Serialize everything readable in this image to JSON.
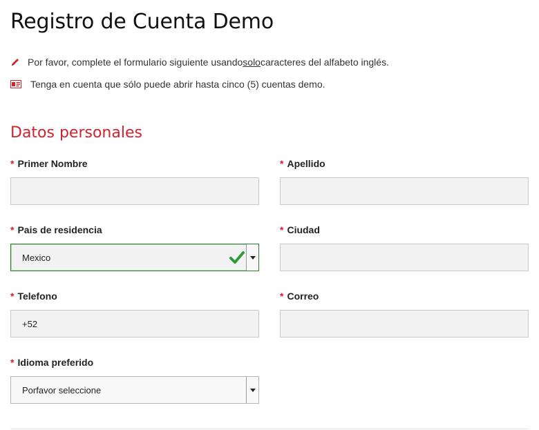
{
  "page": {
    "title": "Registro de Cuenta Demo"
  },
  "notes": [
    {
      "icon": "pencil-icon",
      "before": "Por favor, complete el formulario siguiente usando ",
      "emph": "solo",
      "after": " caracteres del alfabeto inglés."
    },
    {
      "icon": "id-card-icon",
      "text": "Tenga en cuenta que sólo puede abrir hasta cinco (5) cuentas demo."
    }
  ],
  "section": {
    "title": "Datos personales"
  },
  "required_marker": "*",
  "fields": {
    "first_name": {
      "label": "Primer Nombre",
      "value": ""
    },
    "last_name": {
      "label": "Apellido",
      "value": ""
    },
    "country": {
      "label": "Pais de residencia",
      "value": "Mexico"
    },
    "city": {
      "label": "Ciudad",
      "value": ""
    },
    "phone": {
      "label": "Telefono",
      "value": "+52"
    },
    "email": {
      "label": "Correo",
      "value": ""
    },
    "language": {
      "label": "Idioma preferido",
      "value": "Porfavor seleccione"
    }
  },
  "colors": {
    "accent": "#d0232b",
    "valid": "#2e9b3a",
    "field_bg": "#f2f2f2"
  }
}
